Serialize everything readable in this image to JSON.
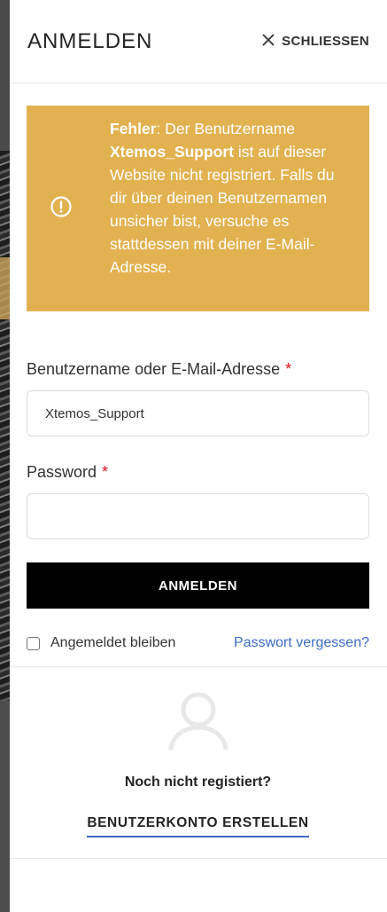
{
  "header": {
    "title": "ANMELDEN",
    "close_label": "SCHLIESSEN"
  },
  "notice": {
    "strong_label": "Fehler",
    "text_1": ": Der Benutzername ",
    "username": "Xtemos_Support",
    "text_2": " ist auf dieser Website nicht registriert. Falls du dir über deinen Benutzernamen unsicher bist, versuche es stattdessen mit deiner E-Mail-Adresse.",
    "icon": "exclamation-circle-icon",
    "color": "#e2b250"
  },
  "form": {
    "username_label": "Benutzername oder E-Mail-Adresse",
    "username_required": "*",
    "username_value": "Xtemos_Support",
    "password_label": "Password",
    "password_required": "*",
    "password_value": "",
    "submit_label": "ANMELDEN",
    "remember_label": "Angemeldet bleiben",
    "remember_checked": false,
    "forgot_label": "Passwort vergessen?"
  },
  "register": {
    "icon": "user-icon",
    "question": "Noch nicht registiert?",
    "create_label": "BENUTZERKONTO ERSTELLEN"
  },
  "colors": {
    "accent_link": "#3b6dc4",
    "required": "#e01020",
    "button_bg": "#000000"
  }
}
